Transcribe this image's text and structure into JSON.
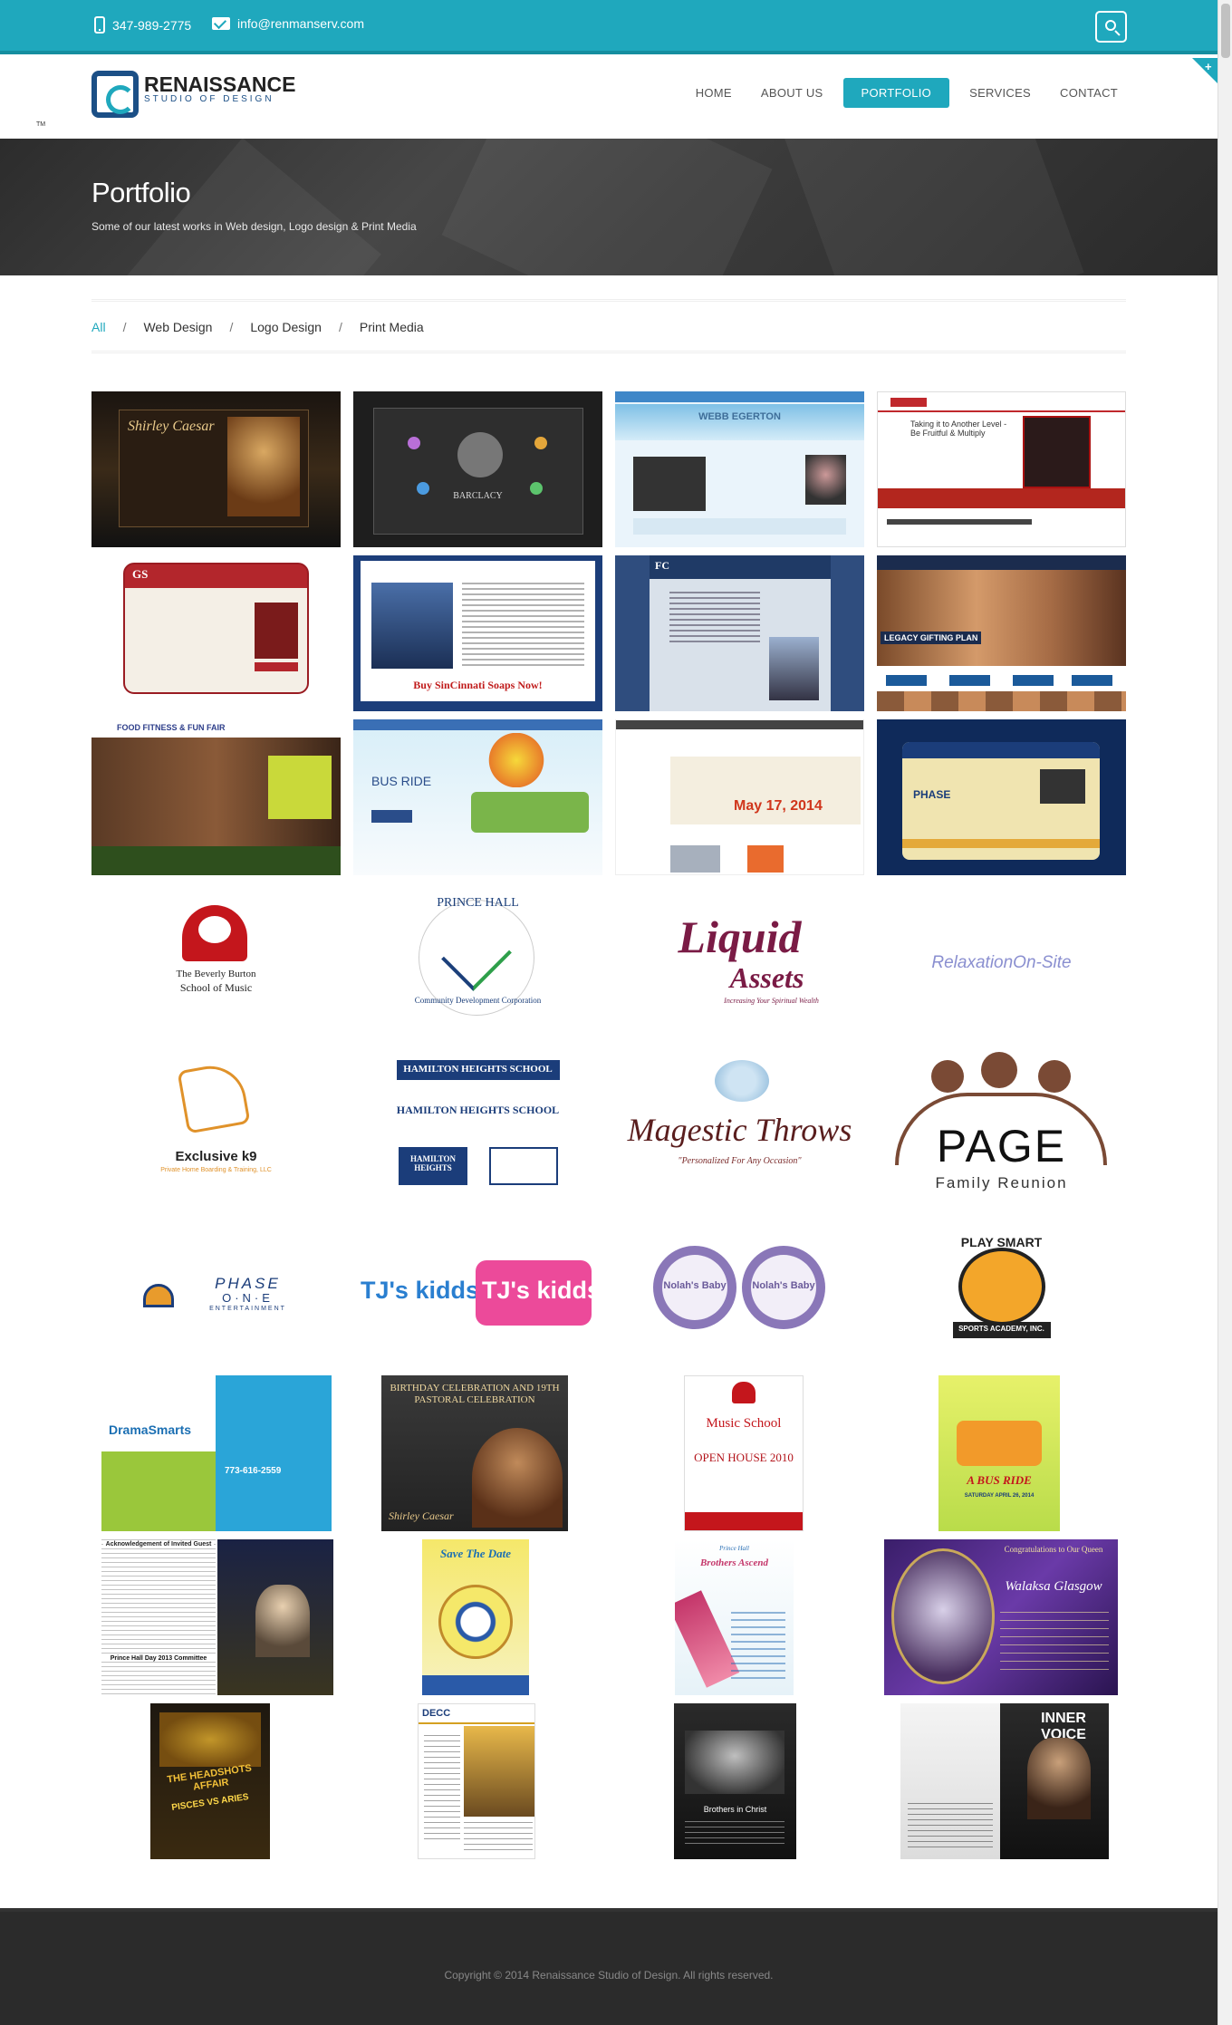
{
  "topbar": {
    "phone": "347-989-2775",
    "email": "info@renmanserv.com"
  },
  "brand": {
    "name": "RENAISSANCE",
    "tagline": "STUDIO OF DESIGN",
    "tm": "TM"
  },
  "nav": {
    "items": [
      "HOME",
      "ABOUT US",
      "PORTFOLIO",
      "SERVICES",
      "CONTACT"
    ],
    "active": "PORTFOLIO"
  },
  "banner": {
    "title": "Portfolio",
    "subtitle": "Some of our latest works in Web design, Logo design & Print Media"
  },
  "filters": {
    "items": [
      "All",
      "Web Design",
      "Logo Design",
      "Print Media"
    ],
    "active": "All",
    "separator": "/"
  },
  "web_thumbs": [
    {
      "kind": "web",
      "text": "Shirley Caesar"
    },
    {
      "kind": "web",
      "text": "BARCLACY"
    },
    {
      "kind": "web",
      "text": "WEBB EGERTON"
    },
    {
      "kind": "web",
      "text": "Taking it to Another Level - Be Fruitful & Multiply"
    },
    {
      "kind": "web",
      "text": "GS"
    },
    {
      "kind": "web",
      "text": "Buy SinCinnati Soaps Now!"
    },
    {
      "kind": "web",
      "text": "FC"
    },
    {
      "kind": "web",
      "text": "LEGACY GIFTING PLAN"
    },
    {
      "kind": "web",
      "text": "FOOD FITNESS & FUN FAIR"
    },
    {
      "kind": "web",
      "text": "BUS RIDE"
    },
    {
      "kind": "web",
      "text": "May 17, 2014"
    },
    {
      "kind": "web",
      "text": "PHASE"
    }
  ],
  "logos": [
    {
      "line1": "The Beverly Burton",
      "line2": "School of Music"
    },
    {
      "line1": "PRINCE HALL",
      "line2": "Community Development Corporation"
    },
    {
      "line1": "Liquid",
      "line2": "Assets",
      "line3": "Increasing Your Spiritual Wealth"
    },
    {
      "line1": "RelaxationOn-Site"
    },
    {
      "line1": "Exclusive k9",
      "line2": "Private Home Boarding & Training, LLC"
    },
    {
      "line1": "HAMILTON HEIGHTS SCHOOL",
      "line2": "HAMILTON HEIGHTS SCHOOL",
      "line3": "HAMILTON HEIGHTS"
    },
    {
      "line1": "Magestic Throws",
      "line2": "\"Personalized For Any Occasion\""
    },
    {
      "line1": "PAGE",
      "line2": "Family Reunion"
    },
    {
      "line1": "PHASE",
      "line2": "O·N·E",
      "line3": "ENTERTAINMENT"
    },
    {
      "line1": "TJ's kidds",
      "line2": "TJ's kidds"
    },
    {
      "line1": "Nolah's Baby",
      "line2": "Nolah's Baby"
    },
    {
      "line1": "PLAY SMART",
      "line2": "SPORTS ACADEMY, INC."
    }
  ],
  "prints": [
    {
      "text": "DramaSmarts",
      "sub": "773-616-2559"
    },
    {
      "text": "BIRTHDAY CELEBRATION AND 19TH PASTORAL CELEBRATION",
      "sub": "Shirley Caesar"
    },
    {
      "text": "Music School",
      "sub": "OPEN HOUSE 2010"
    },
    {
      "text": "A BUS RIDE",
      "sub": "SATURDAY APRIL 26, 2014"
    },
    {
      "text": "Acknowledgement of Invited Guest",
      "sub": "Prince Hall Day 2013 Committee"
    },
    {
      "text": "Save The Date",
      "sub": ""
    },
    {
      "text": "Prince Hall",
      "sub": "Brothers Ascend"
    },
    {
      "text": "Congratulations to Our Queen",
      "sub": "Walaksa Glasgow"
    },
    {
      "text": "THE HEADSHOTS AFFAIR",
      "sub": "PISCES VS ARIES"
    },
    {
      "text": "DECC",
      "sub": ""
    },
    {
      "text": "Brothers in Christ",
      "sub": ""
    },
    {
      "text": "INNER VOICE",
      "sub": ""
    }
  ],
  "footer": {
    "copyright": "Copyright © 2014 Renaissance Studio of Design. All rights reserved."
  },
  "colors": {
    "accent": "#1fa8bd",
    "brand_blue": "#1b4f86",
    "banner": "#3a3a3a",
    "footer": "#2b2b2b"
  }
}
